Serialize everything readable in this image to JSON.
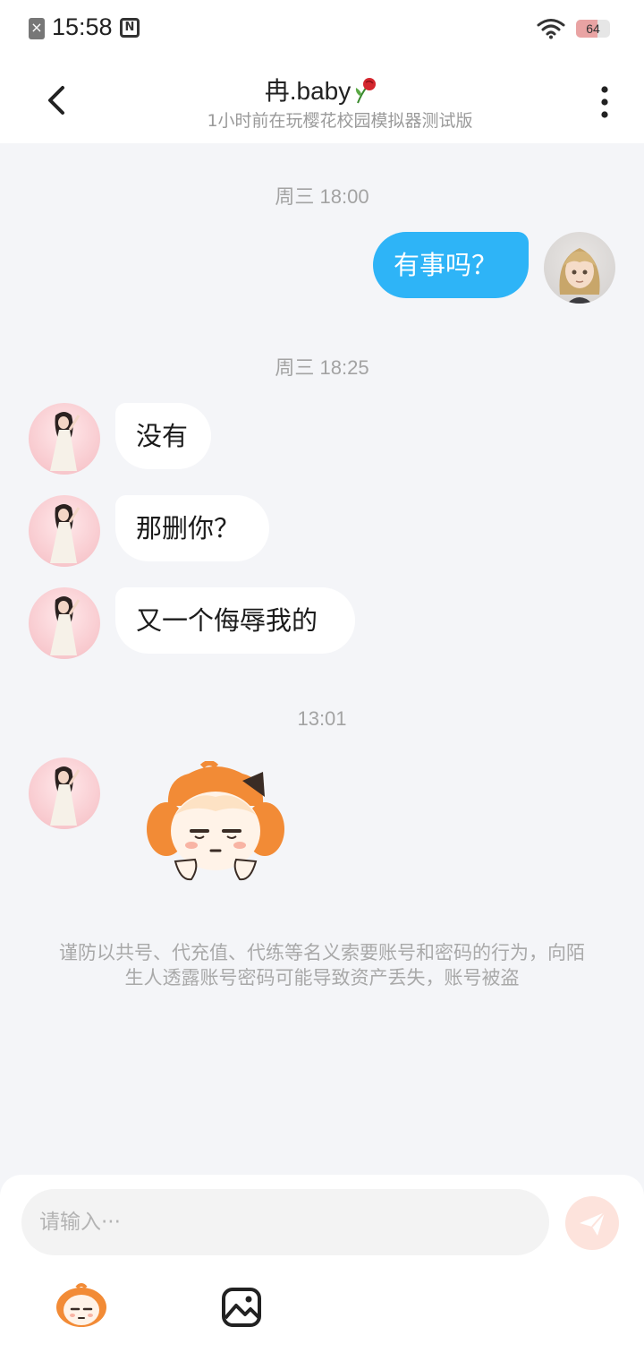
{
  "status_bar": {
    "time": "15:58",
    "nfc_icon": "nfc-icon",
    "battery_level": "64",
    "battery_fraction": 0.64
  },
  "header": {
    "title": "冉.baby",
    "subtitle": "1小时前在玩樱花校园模拟器测试版"
  },
  "messages": {
    "ts1": "周三 18:00",
    "out1": "有事吗？",
    "ts2": "周三 18:25",
    "in1": "没有",
    "in2": "那删你？",
    "in3": "又一个侮辱我的",
    "ts3": "13:01"
  },
  "notice": "谨防以共号、代充值、代练等名义索要账号和密码的行为，向陌生人透露账号密码可能导致资产丢失，账号被盗",
  "composer": {
    "placeholder": "请输入···"
  },
  "colors": {
    "outgoing_bubble": "#2eb4f7",
    "incoming_bubble": "#ffffff",
    "background": "#f4f5f8",
    "send_button": "#fde3dc"
  },
  "icons": [
    "back-arrow-icon",
    "more-vertical-icon",
    "send-icon",
    "emoji-sticker-icon",
    "image-icon",
    "wifi-icon",
    "sim-icon",
    "rose-icon"
  ]
}
